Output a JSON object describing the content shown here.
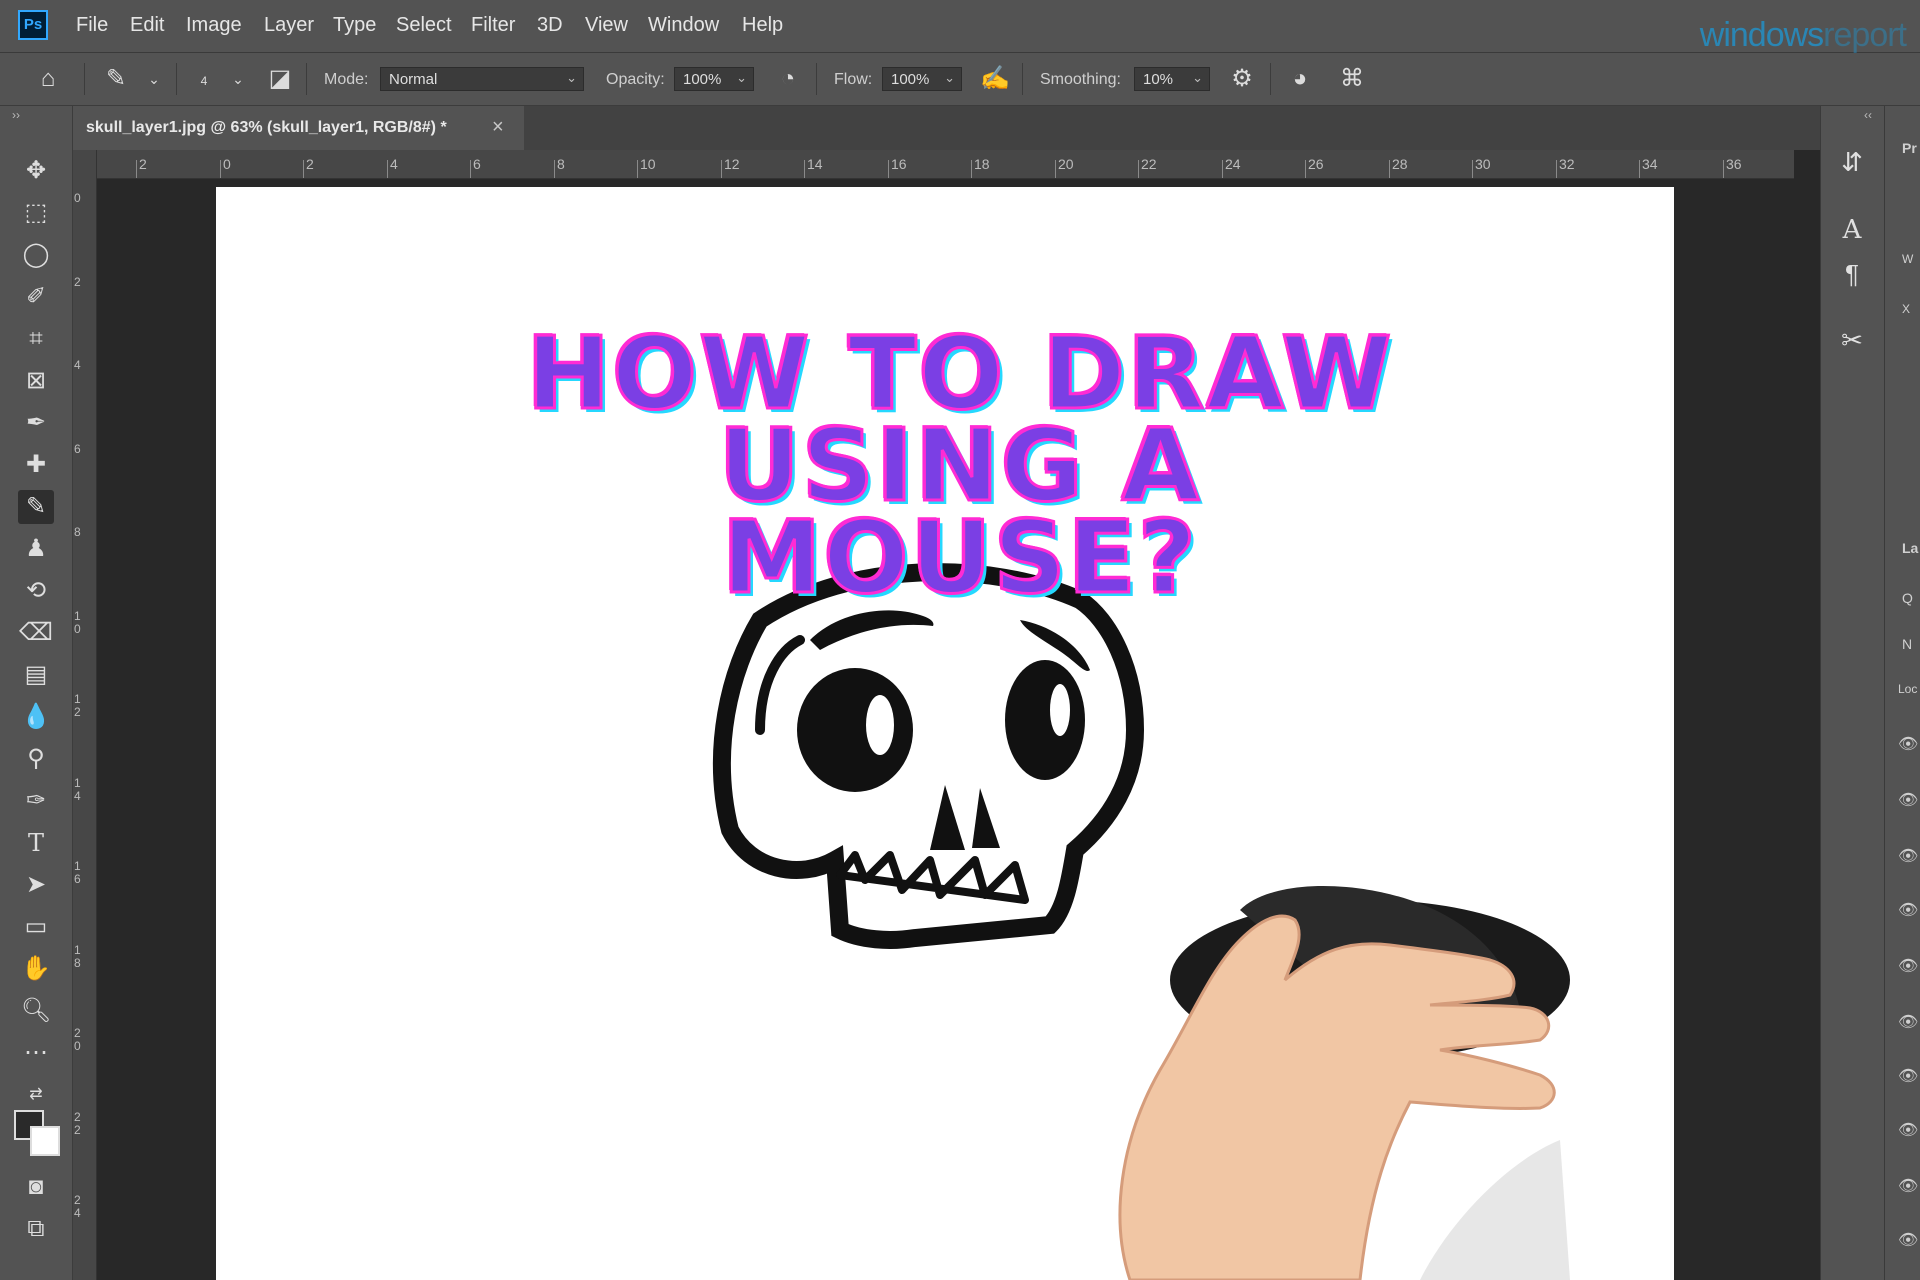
{
  "app": {
    "logo": "Ps"
  },
  "menu": [
    "File",
    "Edit",
    "Image",
    "Layer",
    "Type",
    "Select",
    "Filter",
    "3D",
    "View",
    "Window",
    "Help"
  ],
  "watermark": {
    "main": "windows",
    "tail": "report"
  },
  "options": {
    "brush_size": "4",
    "mode_label": "Mode:",
    "mode_value": "Normal",
    "opacity_label": "Opacity:",
    "opacity_value": "100%",
    "flow_label": "Flow:",
    "flow_value": "100%",
    "smoothing_label": "Smoothing:",
    "smoothing_value": "10%"
  },
  "document": {
    "tab_title": "skull_layer1.jpg @ 63% (skull_layer1, RGB/8#) *",
    "close_glyph": "×"
  },
  "rulers": {
    "top": [
      "2",
      "0",
      "2",
      "4",
      "6",
      "8",
      "10",
      "12",
      "14",
      "16",
      "18",
      "20",
      "22",
      "24",
      "26",
      "28",
      "30",
      "32",
      "34",
      "36"
    ],
    "left": [
      "0",
      "2",
      "4",
      "6",
      "8",
      "1 0",
      "1 2",
      "1 4",
      "1 6",
      "1 8",
      "2 0",
      "2 2",
      "2 4"
    ]
  },
  "headline": {
    "line1": "HOW TO DRAW",
    "line2": "USING A",
    "line3": "MOUSE?"
  },
  "right_panel": {
    "properties_abbr": "Pr",
    "w_abbr": "W",
    "x_abbr": "X",
    "layers_abbr": "La",
    "search_abbr": "Q",
    "normal_abbr": "N",
    "lock_abbr": "Loc"
  },
  "colors": {
    "accent_purple": "#7b3fe4",
    "accent_magenta": "#ff2bd4",
    "accent_cyan": "#25d8ff",
    "ui_panel": "#535353",
    "canvas_bg": "#282828"
  }
}
